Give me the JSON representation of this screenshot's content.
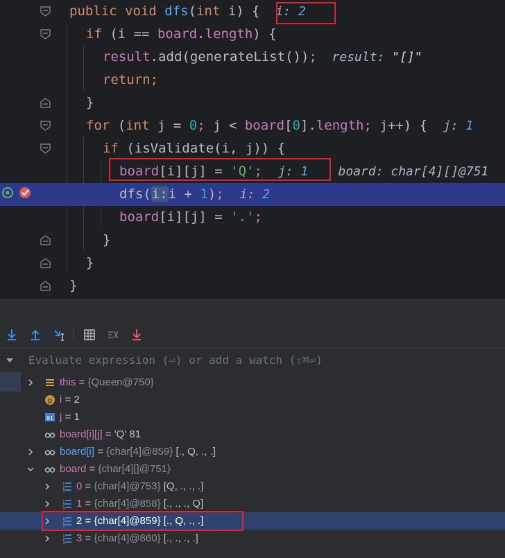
{
  "code": {
    "lines": [
      {
        "parts": [
          [
            "kw",
            "public void "
          ],
          [
            "fn",
            "dfs"
          ],
          [
            "p",
            "("
          ],
          [
            "kw",
            "int "
          ],
          [
            "p",
            "i) {  "
          ]
        ],
        "inline": [
          [
            "l",
            "i: "
          ],
          [
            "v",
            "2"
          ]
        ]
      },
      {
        "parts": [
          [
            "kw",
            "if "
          ],
          [
            "p",
            "(i == "
          ],
          [
            "field",
            "board"
          ],
          [
            "p",
            "."
          ],
          [
            "field",
            "length"
          ],
          [
            "p",
            ") {"
          ]
        ]
      },
      {
        "parts": [
          [
            "field",
            "result"
          ],
          [
            "p",
            ".add(generateList())"
          ],
          [
            "kw",
            ";"
          ]
        ],
        "inline": [
          [
            "l",
            "  result: "
          ],
          [
            "s",
            "\"[]\""
          ]
        ]
      },
      {
        "parts": [
          [
            "kw",
            "return;"
          ]
        ]
      },
      {
        "parts": [
          [
            "p",
            "}"
          ]
        ]
      },
      {
        "parts": [
          [
            "kw",
            "for "
          ],
          [
            "p",
            "("
          ],
          [
            "kw",
            "int "
          ],
          [
            "p",
            "j = "
          ],
          [
            "num",
            "0"
          ],
          [
            "kw",
            "; "
          ],
          [
            "p",
            "j < "
          ],
          [
            "field",
            "board"
          ],
          [
            "p",
            "["
          ],
          [
            "num",
            "0"
          ],
          [
            "p",
            "]."
          ],
          [
            "field",
            "length"
          ],
          [
            "kw",
            "; "
          ],
          [
            "p",
            "j++) {  "
          ]
        ],
        "inline": [
          [
            "l",
            "j: "
          ],
          [
            "v",
            "1"
          ]
        ]
      },
      {
        "parts": [
          [
            "kw",
            "if "
          ],
          [
            "p",
            "(isValidate(i, j)) {"
          ]
        ]
      },
      {
        "parts": [
          [
            "field",
            "board"
          ],
          [
            "p",
            "[i][j] = "
          ],
          [
            "str",
            "'Q'"
          ],
          [
            "kw",
            ";  "
          ]
        ],
        "inline": [
          [
            "l",
            "j: "
          ],
          [
            "v",
            "1"
          ],
          [
            "l",
            "    board: char[4][]@751"
          ]
        ]
      },
      {
        "parts": [
          [
            "p",
            "dfs("
          ],
          [
            "hint",
            "i:"
          ],
          [
            "p",
            "i + "
          ],
          [
            "num",
            "1"
          ],
          [
            "p",
            ")"
          ],
          [
            "kw",
            ";  "
          ]
        ],
        "inline": [
          [
            "l",
            "i: "
          ],
          [
            "v",
            "2"
          ]
        ]
      },
      {
        "parts": [
          [
            "field",
            "board"
          ],
          [
            "p",
            "[i][j] = "
          ],
          [
            "str",
            "'.'"
          ],
          [
            "kw",
            ";"
          ]
        ]
      },
      {
        "parts": [
          [
            "p",
            "}"
          ]
        ]
      },
      {
        "parts": [
          [
            "p",
            "}"
          ]
        ]
      },
      {
        "parts": [
          [
            "p",
            "}"
          ]
        ]
      }
    ]
  },
  "toolbar": {
    "icons": [
      "step-over-icon",
      "step-into-icon",
      "step-out-icon",
      "run-to-cursor-icon",
      "evaluate-icon",
      "trace-icon",
      "drop-frame-icon"
    ]
  },
  "evaluate": {
    "placeholder": "Evaluate expression (⏎) or add a watch (⇧⌘⏎)"
  },
  "variables": [
    {
      "name": "this",
      "eq": " = ",
      "type": "{Queen@750}",
      "value": "",
      "icon": "field-icon",
      "expand": "collapsed"
    },
    {
      "name": "i",
      "eq": " = ",
      "type": "",
      "value": "2",
      "icon": "parameter-icon",
      "expand": "none"
    },
    {
      "name": "j",
      "eq": " = ",
      "type": "",
      "value": "1",
      "icon": "local-variable-icon",
      "expand": "none"
    },
    {
      "name": "board[i][j]",
      "eq": " = ",
      "type": "",
      "value": "'Q' 81",
      "icon": "watch-icon",
      "expand": "none"
    },
    {
      "name": "board[i]",
      "eq": " = ",
      "type": "{char[4]@859}",
      "value": " [., Q, ., .]",
      "icon": "watch-icon",
      "expand": "collapsed",
      "blue": true
    },
    {
      "name": "board",
      "eq": " = ",
      "type": "{char[4][]@751}",
      "value": "",
      "icon": "watch-icon",
      "expand": "expanded"
    },
    {
      "name": "0",
      "eq": " = ",
      "type": "{char[4]@753}",
      "value": " [Q, ., ., .]",
      "icon": "array-item-icon",
      "expand": "collapsed",
      "indent": true
    },
    {
      "name": "1",
      "eq": " = ",
      "type": "{char[4]@858}",
      "value": " [., ., ., Q]",
      "icon": "array-item-icon",
      "expand": "collapsed",
      "indent": true
    },
    {
      "name": "2",
      "eq": " = ",
      "type": "{char[4]@859}",
      "value": " [., Q, ., .]",
      "icon": "array-item-icon",
      "expand": "collapsed",
      "indent": true,
      "selected": true
    },
    {
      "name": "3",
      "eq": " = ",
      "type": "{char[4]@860}",
      "value": " [., ., ., .]",
      "icon": "array-item-icon",
      "expand": "collapsed",
      "indent": true
    }
  ],
  "colors": {
    "exec_line": "#2d3a8c",
    "highlight_box": "#e0242f",
    "selected_row": "#2e436e"
  }
}
